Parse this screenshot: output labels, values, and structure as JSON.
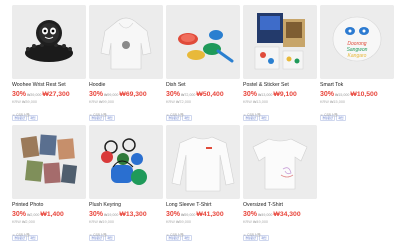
{
  "products": [
    {
      "name": "Woohee Wrist Rest Set",
      "discount": "30%",
      "orig_small": "₩39,000",
      "price": "₩27,300",
      "krw": "KRW ₩39,000",
      "tags": [
        "결정문판",
        "재입"
      ],
      "meta": "☺ CSR 신품"
    },
    {
      "name": "Hoodie",
      "discount": "30%",
      "orig_small": "₩99,000",
      "price": "₩69,300",
      "krw": "KRW ₩99,000",
      "tags": [
        "결정문판",
        "재입"
      ],
      "meta": "☺ CSR 신품"
    },
    {
      "name": "Dish Set",
      "discount": "30%",
      "orig_small": "₩72,000",
      "price": "₩50,400",
      "krw": "KRW ₩72,000",
      "tags": [
        "결정문판",
        "재입"
      ],
      "meta": "☺ CSR 신품"
    },
    {
      "name": "Postel & Sticker Set",
      "discount": "30%",
      "orig_small": "₩13,000",
      "price": "₩9,100",
      "krw": "KRW ₩13,000",
      "tags": [
        "결정문판",
        "재입"
      ],
      "meta": "☺ CSR 신품"
    },
    {
      "name": "Smart Tok",
      "discount": "30%",
      "orig_small": "₩15,000",
      "price": "₩10,500",
      "krw": "KRW ₩15,000",
      "tags": [
        "결정문판",
        "재입"
      ],
      "meta": "☺ CSR 신품"
    },
    {
      "name": "Printed Photo",
      "discount": "30%",
      "orig_small": "₩2,000",
      "price": "₩1,400",
      "krw": "KRW ₩2,000",
      "tags": [
        "결정문판",
        "재입"
      ],
      "meta": "☺ CSR 신품"
    },
    {
      "name": "Plush Keyring",
      "discount": "30%",
      "orig_small": "₩19,000",
      "price": "₩13,300",
      "krw": "KRW ₩19,000",
      "tags": [
        "결정문판",
        "재입"
      ],
      "meta": "☺ CSR 신품"
    },
    {
      "name": "Long Sleeve T-Shirt",
      "discount": "30%",
      "orig_small": "₩59,000",
      "price": "₩41,300",
      "krw": "KRW ₩59,000",
      "tags": [
        "결정문판",
        "재입"
      ],
      "meta": "☺ CSR 신품"
    },
    {
      "name": "Oversized T-Shirt",
      "discount": "30%",
      "orig_small": "₩49,000",
      "price": "₩34,300",
      "krw": "KRW ₩49,000",
      "tags": [
        "결정문판",
        "재입"
      ],
      "meta": "☺ CSR 신품"
    }
  ],
  "smart_tok_art": {
    "line1": "Doorong",
    "line2": "Sangwon",
    "line3": "Kangaro"
  },
  "colors": {
    "accent": "#e8463c",
    "tag_border": "#cfd7ee",
    "tag_text": "#5570c8",
    "image_bg": "#efefef"
  },
  "icons": [
    "alien-pad-illustration",
    "hoodie-illustration",
    "dish-set-illustration",
    "postcard-set-illustration",
    "smart-tok-illustration",
    "photo-cards-illustration",
    "keyring-illustration",
    "long-sleeve-shirt-illustration",
    "oversized-shirt-illustration"
  ]
}
